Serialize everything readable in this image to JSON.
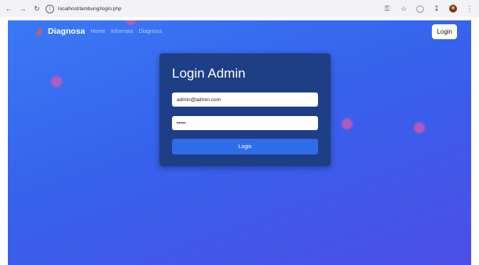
{
  "browser": {
    "url": "localhost/lambung/login.php",
    "back_icon": "back-arrow-icon",
    "forward_icon": "forward-arrow-icon",
    "reload_icon": "reload-icon"
  },
  "navbar": {
    "brand": "Diagnosa",
    "links": [
      "Home",
      "Informasi",
      "Diagnosa"
    ],
    "login_button": "Login"
  },
  "login_card": {
    "title": "Login Admin",
    "email_value": "admin@admin.com",
    "password_value": "•••••",
    "submit_label": "Login"
  },
  "colors": {
    "page_gradient_start": "#3b79f5",
    "page_gradient_end": "#4c4ee6",
    "card_background": "#1e3f86",
    "button_background": "#2f6de8",
    "brand_icon": "#ff4e3e",
    "blob": "#d759b0"
  }
}
